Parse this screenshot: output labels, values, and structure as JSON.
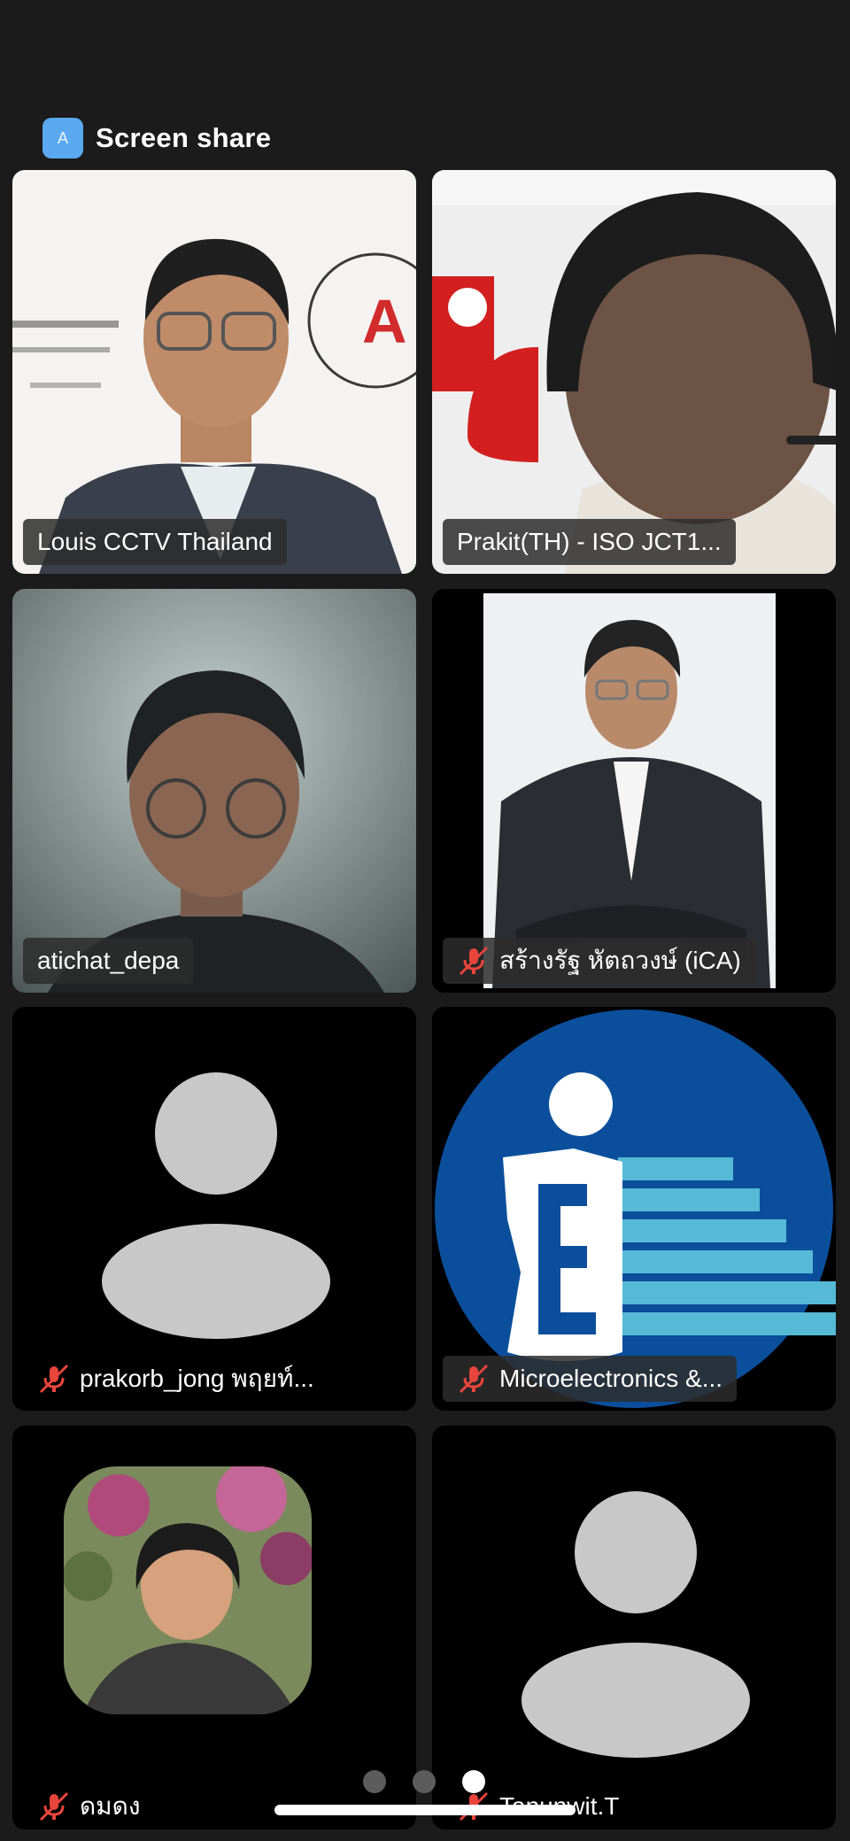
{
  "header": {
    "badge_letter": "A",
    "title": "Screen share"
  },
  "participants": [
    {
      "name": "Louis CCTV Thailand",
      "muted": false,
      "active_speaker": true
    },
    {
      "name": "Prakit(TH) - ISO JCT1...",
      "muted": false,
      "active_speaker": false
    },
    {
      "name": "atichat_depa",
      "muted": false,
      "active_speaker": false
    },
    {
      "name": "สร้างรัฐ หัตถวงษ์ (iCA)",
      "muted": true,
      "active_speaker": false
    },
    {
      "name": "prakorb_jong พฤยท์...",
      "muted": true,
      "active_speaker": false
    },
    {
      "name": "Microelectronics &...",
      "muted": true,
      "active_speaker": false
    },
    {
      "name": "ดมดง",
      "muted": true,
      "active_speaker": false
    },
    {
      "name": "Tanunwit.T",
      "muted": true,
      "active_speaker": false
    }
  ],
  "pagination": {
    "pages": 3,
    "current": 3
  },
  "colors": {
    "active_speaker_border": "#3ecf57",
    "muted_icon": "#e8453c",
    "share_badge": "#5aa9f0"
  }
}
